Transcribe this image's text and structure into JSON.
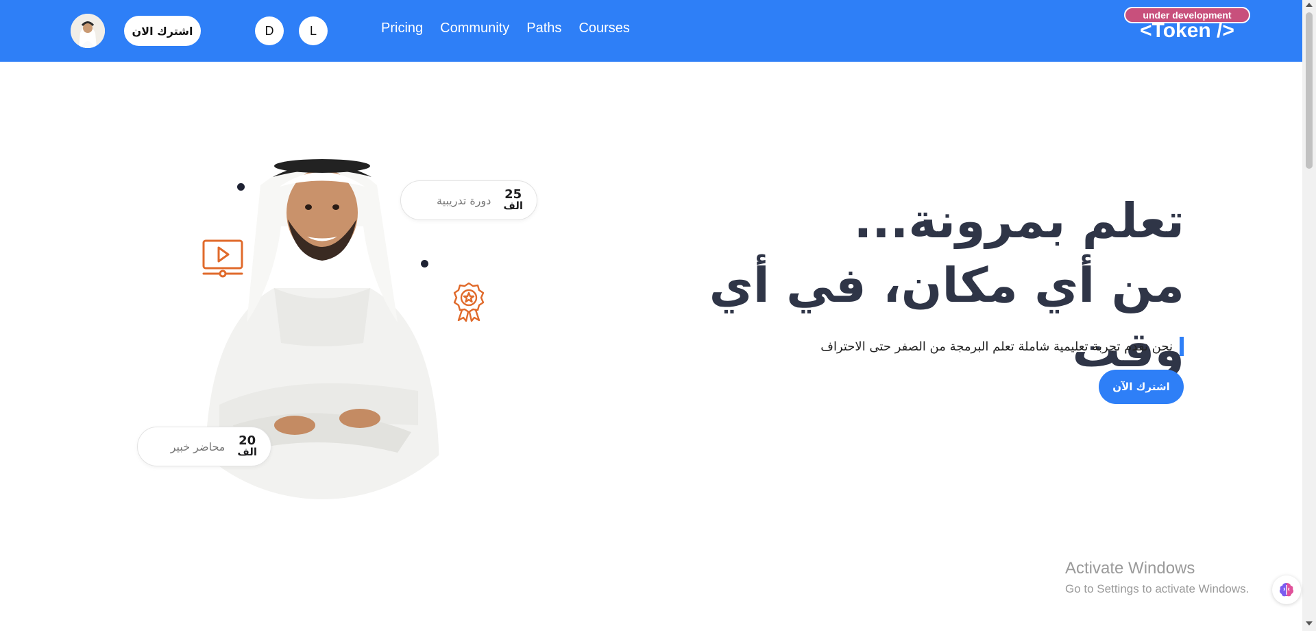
{
  "header": {
    "subscribe_label": "اشترك الان",
    "toggle_dark_label": "D",
    "toggle_light_label": "L",
    "nav": [
      {
        "label": "Pricing"
      },
      {
        "label": "Community"
      },
      {
        "label": "Paths"
      },
      {
        "label": "Courses"
      }
    ],
    "dev_badge": "under development",
    "logo": "<Token />"
  },
  "hero": {
    "title_line1": "تعلم بمرونة...",
    "title_line2": "من أي مكان، في أي وقت",
    "subtitle": "نحن نقدم تجربة تعليمية شاملة تعلم البرمجة من الصفر حتى الاحتراف",
    "cta_label": "اشترك الآن"
  },
  "stats": [
    {
      "number": "25",
      "unit": "الف",
      "label": "دورة تدريبية"
    },
    {
      "number": "20",
      "unit": "الف",
      "label": "محاضر خبير"
    }
  ],
  "icons": {
    "video": "video-play-icon",
    "award": "award-badge-icon",
    "assistant": "brain-assistant-icon"
  },
  "colors": {
    "primary": "#2e7ff7",
    "badge": "#c8507c",
    "accent_orange": "#e06a2b",
    "heading": "#2f3547"
  },
  "watermark": {
    "title": "Activate Windows",
    "subtitle": "Go to Settings to activate Windows."
  }
}
